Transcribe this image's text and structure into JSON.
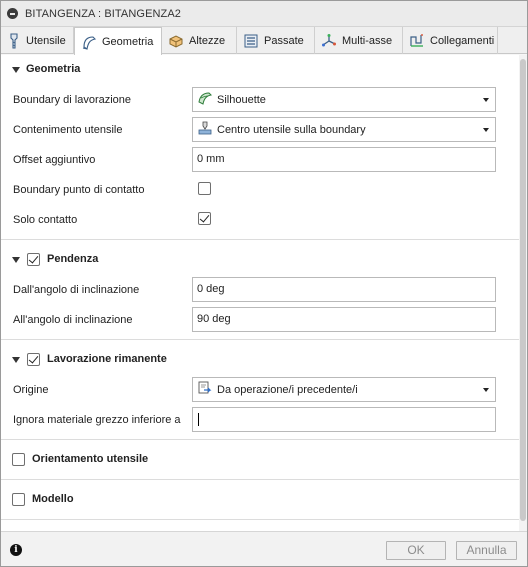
{
  "window": {
    "title": "BITANGENZA : BITANGENZA2"
  },
  "tabs": [
    {
      "label": "Utensile",
      "icon": "tool-icon"
    },
    {
      "label": "Geometria",
      "icon": "geometry-icon",
      "active": true
    },
    {
      "label": "Altezze",
      "icon": "heights-icon"
    },
    {
      "label": "Passate",
      "icon": "passes-icon"
    },
    {
      "label": "Multi-asse",
      "icon": "multi-axis-icon"
    },
    {
      "label": "Collegamenti",
      "icon": "linking-icon"
    }
  ],
  "geometria": {
    "title": "Geometria",
    "boundary_label": "Boundary di lavorazione",
    "boundary_value": "Silhouette",
    "containment_label": "Contenimento utensile",
    "containment_value": "Centro utensile sulla boundary",
    "offset_label": "Offset aggiuntivo",
    "offset_value": "0 mm",
    "contact_boundary_label": "Boundary punto di contatto",
    "contact_boundary_checked": false,
    "contact_only_label": "Solo contatto",
    "contact_only_checked": true
  },
  "pendenza": {
    "title": "Pendenza",
    "checked": true,
    "from_label": "Dall'angolo di inclinazione",
    "from_value": "0 deg",
    "to_label": "All'angolo di inclinazione",
    "to_value": "90 deg"
  },
  "rimanente": {
    "title": "Lavorazione rimanente",
    "checked": true,
    "origin_label": "Origine",
    "origin_value": "Da operazione/i precedente/i",
    "ignore_label": "Ignora materiale grezzo inferiore a",
    "ignore_value": ""
  },
  "orientamento": {
    "title": "Orientamento utensile",
    "checked": false
  },
  "modello": {
    "title": "Modello",
    "checked": false
  },
  "footer": {
    "ok_label": "OK",
    "cancel_label": "Annulla"
  },
  "colors": {
    "field_border": "#b9b9b9",
    "panel_bg": "#ffffff",
    "disabled_text": "#8c8c8c"
  }
}
